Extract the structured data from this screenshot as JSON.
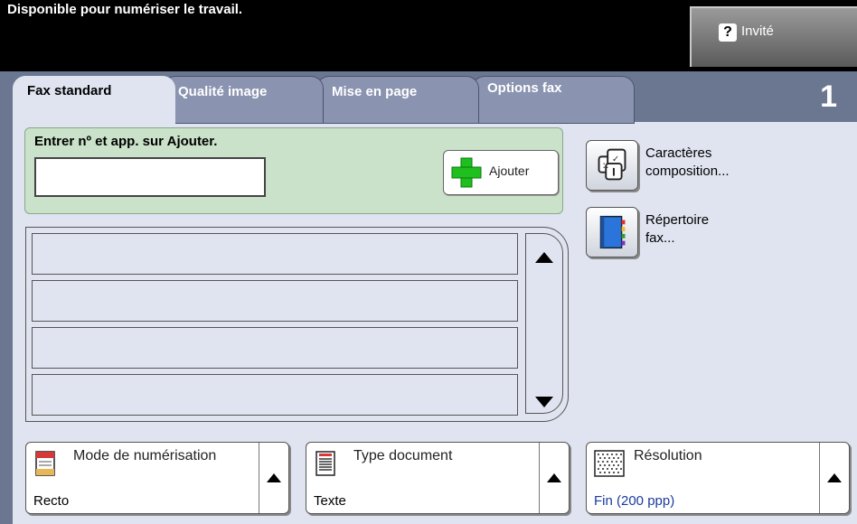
{
  "status": {
    "message": "Disponible pour numériser le travail."
  },
  "user": {
    "help_glyph": "?",
    "label": "Invité"
  },
  "tabs": [
    {
      "label": "Fax standard",
      "active": true
    },
    {
      "label": "Qualité image"
    },
    {
      "label": "Mise en page"
    },
    {
      "label": "Options fax"
    }
  ],
  "job_count": "1",
  "entry": {
    "label": "Entrer nº et app. sur Ajouter.",
    "value": "",
    "add_label": "Ajouter"
  },
  "side_buttons": [
    {
      "label": "Caractères\ncomposition...",
      "icon": "dial-characters-icon"
    },
    {
      "label": "Répertoire\nfax...",
      "icon": "address-book-icon"
    }
  ],
  "bottom_buttons": [
    {
      "title": "Mode de numérisation",
      "value": "Recto",
      "icon": "scan-mode-icon",
      "value_color": "#000000"
    },
    {
      "title": "Type document",
      "value": "Texte",
      "icon": "document-type-icon",
      "value_color": "#000000"
    },
    {
      "title": "Résolution",
      "value": "Fin (200 ppp)",
      "icon": "resolution-icon",
      "value_color": "#1a3aa0"
    }
  ],
  "colors": {
    "accent_green": "#1fbf1f",
    "value_blue": "#1a3aa0",
    "tab_bg": "#6b7791"
  }
}
